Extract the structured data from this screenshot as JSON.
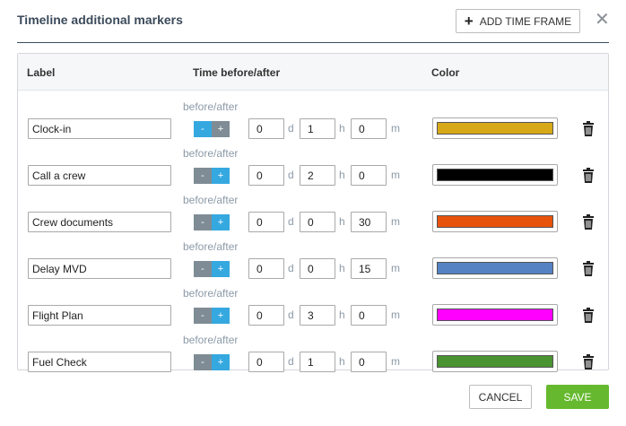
{
  "dialog": {
    "title": "Timeline additional markers",
    "add_button_label": "ADD TIME FRAME",
    "cancel_label": "CANCEL",
    "save_label": "SAVE",
    "save_color": "#66b92e"
  },
  "table": {
    "headers": {
      "label": "Label",
      "time": "Time before/after",
      "color": "Color"
    },
    "before_after_label": "before/after",
    "minus_symbol": "-",
    "plus_symbol": "+",
    "units": {
      "d": "d",
      "h": "h",
      "m": "m"
    },
    "rows": [
      {
        "label": "Clock-in",
        "direction": "before",
        "d": "0",
        "h": "1",
        "m": "0",
        "color": "#d7a919"
      },
      {
        "label": "Call a crew",
        "direction": "after",
        "d": "0",
        "h": "2",
        "m": "0",
        "color": "#000000"
      },
      {
        "label": "Crew documents",
        "direction": "after",
        "d": "0",
        "h": "0",
        "m": "30",
        "color": "#e8530c"
      },
      {
        "label": "Delay MVD",
        "direction": "after",
        "d": "0",
        "h": "0",
        "m": "15",
        "color": "#5582c3"
      },
      {
        "label": "Flight Plan",
        "direction": "after",
        "d": "0",
        "h": "3",
        "m": "0",
        "color": "#ff00ff"
      },
      {
        "label": "Fuel Check",
        "direction": "after",
        "d": "0",
        "h": "1",
        "m": "0",
        "color": "#4a9331"
      }
    ]
  }
}
